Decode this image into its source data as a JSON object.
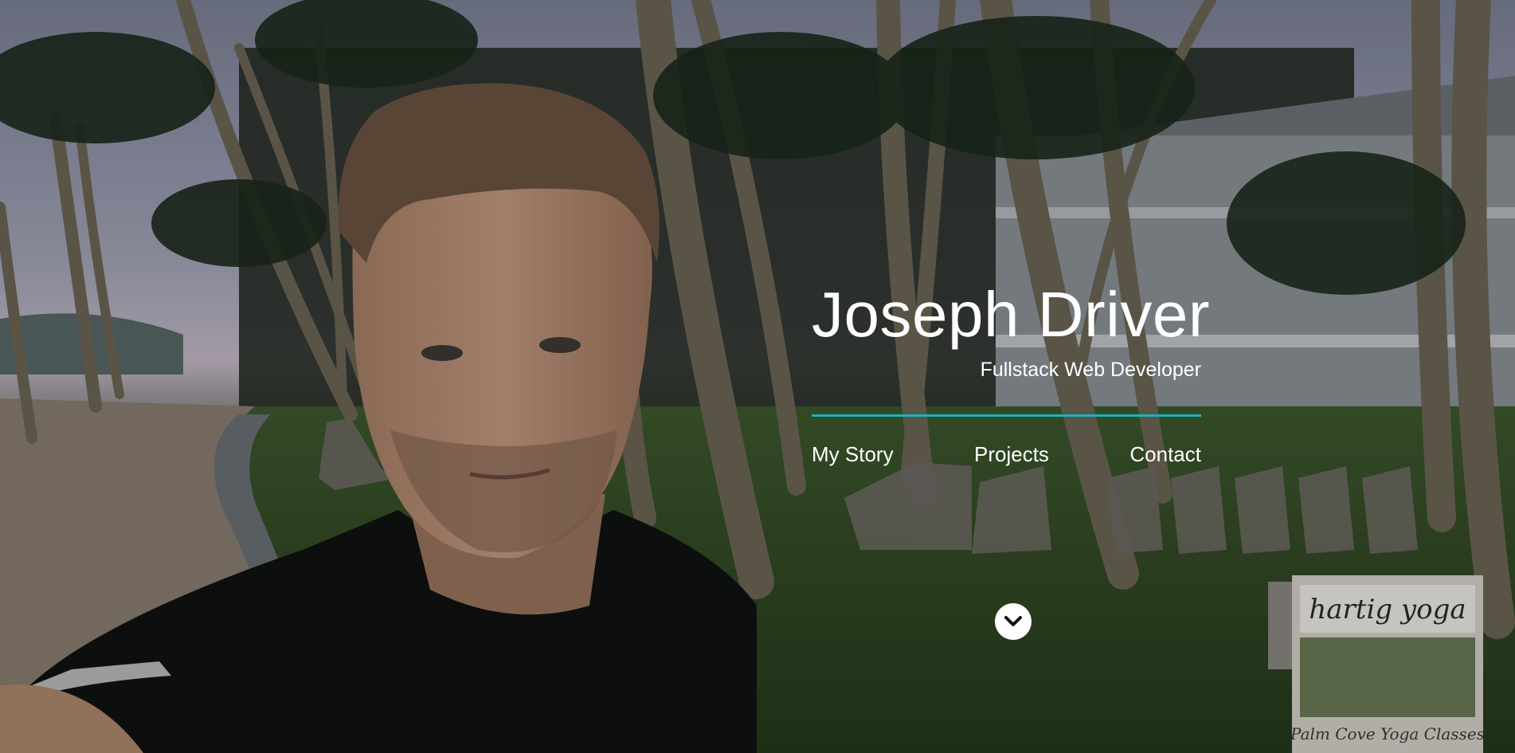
{
  "hero": {
    "title": "Joseph Driver",
    "subtitle": "Fullstack Web Developer",
    "divider_color": "#19b3bd",
    "background_image": "selfie-palm-trees-beach-resort",
    "scroll_icon": "chevron-down-circle-icon"
  },
  "nav": {
    "items": [
      {
        "label": "My Story"
      },
      {
        "label": "Projects"
      },
      {
        "label": "Contact"
      }
    ]
  },
  "signage": {
    "logo_text": "hartig yoga",
    "caption_text": "Palm Cove Yoga Classes"
  }
}
